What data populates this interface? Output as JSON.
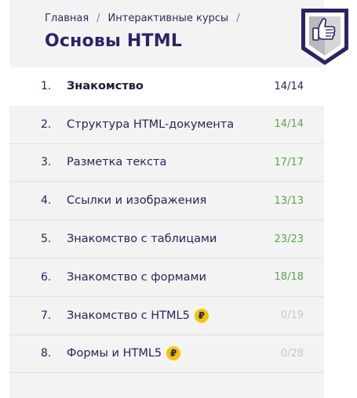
{
  "breadcrumb": {
    "home": "Главная",
    "section": "Интерактивные курсы",
    "separator": "/"
  },
  "page_title": "Основы HTML",
  "badge_icon": "thumbs-up-icon",
  "colors": {
    "title": "#2b2367",
    "completed_count": "#56a845",
    "locked_count": "#c8c8cc",
    "coin": "#f5c400"
  },
  "lessons": [
    {
      "number": "1.",
      "title": "Знакомство",
      "count": "14/14",
      "paid": false,
      "active": true
    },
    {
      "number": "2.",
      "title": "Структура HTML-документа",
      "count": "14/14",
      "paid": false
    },
    {
      "number": "3.",
      "title": "Разметка текста",
      "count": "17/17",
      "paid": false
    },
    {
      "number": "4.",
      "title": "Ссылки и изображения",
      "count": "13/13",
      "paid": false
    },
    {
      "number": "5.",
      "title": "Знакомство с таблицами",
      "count": "23/23",
      "paid": false
    },
    {
      "number": "6.",
      "title": "Знакомство с формами",
      "count": "18/18",
      "paid": false
    },
    {
      "number": "7.",
      "title": "Знакомство с HTML5",
      "count": "0/19",
      "paid": true
    },
    {
      "number": "8.",
      "title": "Формы и HTML5",
      "count": "0/28",
      "paid": true
    }
  ]
}
